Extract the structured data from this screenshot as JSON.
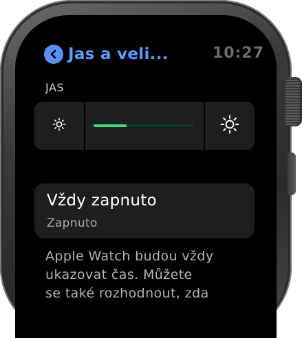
{
  "header": {
    "back_label": "Jas a veli...",
    "time": "10:27"
  },
  "brightness": {
    "section_label": "JAS",
    "level_percent": 33,
    "decrease_icon": "sun-small-icon",
    "increase_icon": "sun-large-icon"
  },
  "always_on": {
    "title": "Vždy zapnuto",
    "value": "Zapnuto"
  },
  "description": {
    "lines": [
      "Apple Watch budou vždy",
      "ukazovat čas. Můžete",
      "se také rozhodnout, zda"
    ]
  },
  "colors": {
    "accent_blue": "#5e9bff",
    "slider_green": "#36e07a",
    "cell_background": "#1e1e20"
  }
}
